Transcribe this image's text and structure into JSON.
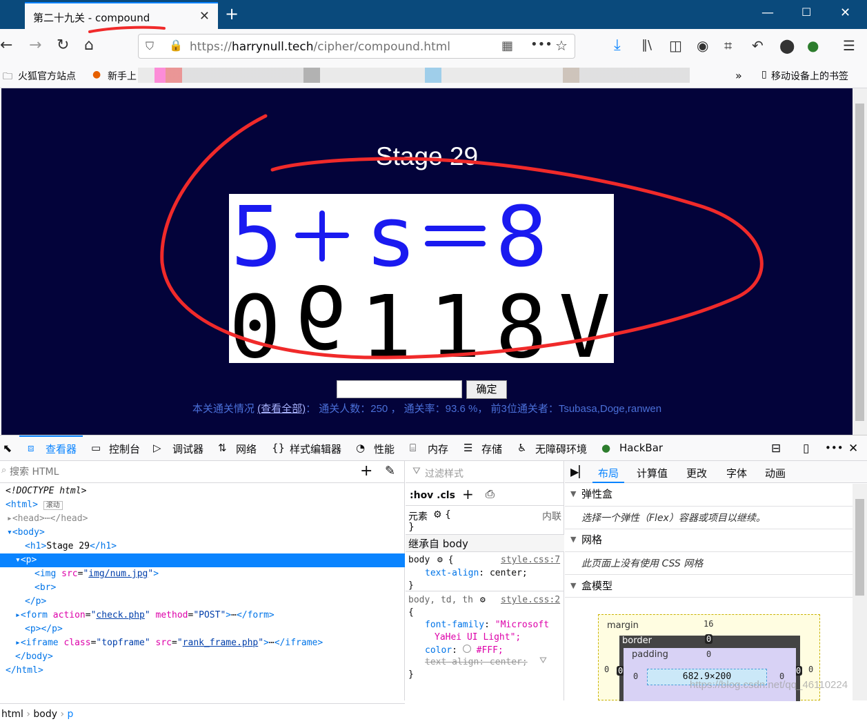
{
  "browser": {
    "tab_title": "第二十九关 - compound",
    "url_prefix": "https://",
    "url_domain": "harrynull.tech",
    "url_path": "/cipher/compound.html",
    "bookmarks": [
      "火狐官方站点",
      "新手上"
    ],
    "bookmarks_right": "移动设备上的书签"
  },
  "page": {
    "title": "Stage 29",
    "puzzle_row1": [
      "5",
      "+",
      "ƨ",
      "=",
      "8"
    ],
    "puzzle_row2": [
      "0",
      "6",
      "1",
      "1",
      "8",
      "V"
    ],
    "submit_label": "确定",
    "rank_prefix": "本关通关情况",
    "rank_link": "(查看全部)",
    "rank_stats": "：  通关人数：250 ，  通关率：93.6 %，  前3位通关者：Tsubasa,Doge,ranwen"
  },
  "devtools": {
    "tabs": [
      "查看器",
      "控制台",
      "调试器",
      "网络",
      "样式编辑器",
      "性能",
      "内存",
      "存储",
      "无障碍环境",
      "HackBar"
    ],
    "search_placeholder": "搜索 HTML",
    "html_lines": [
      "<!DOCTYPE html>",
      "<html> 滚动",
      "▸<head>⋯</head>",
      "▾<body>",
      "  <h1>Stage 29</h1>",
      "▾<p>",
      "    <img src=\"img/num.jpg\">",
      "    <br>",
      "  </p>",
      "▸<form action=\"check.php\" method=\"POST\">⋯</form>",
      "  <p></p>",
      "▸<iframe class=\"topframe\" src=\"rank_frame.php\">⋯</iframe>",
      "  </body>",
      "</html>"
    ],
    "breadcrumbs": [
      "html",
      "body",
      "p"
    ],
    "rules": {
      "filter_placeholder": "过滤样式",
      "hov_cls": ":hov  .cls",
      "element_label": "元素",
      "inline_label": "内联",
      "inherited_label": "继承自 body",
      "rule1_selector": "body",
      "rule1_source": "style.css:7",
      "rule1_prop": "text-align",
      "rule1_value": "center;",
      "rule2_selector": "body, td, th",
      "rule2_source": "style.css:2",
      "rule2_font_prop": "font-family",
      "rule2_font_value1": "\"Microsoft",
      "rule2_font_value2": "YaHei UI Light\";",
      "rule2_color_prop": "color",
      "rule2_color_value": "#FFF;",
      "rule2_struck": "text-align: center;"
    },
    "layout": {
      "tabs": [
        "布局",
        "计算值",
        "更改",
        "字体",
        "动画"
      ],
      "flex_title": "弹性盒",
      "flex_note": "选择一个弹性（Flex）容器或项目以继续。",
      "grid_title": "网格",
      "grid_note": "此页面上没有使用 CSS 网格",
      "boxmodel_title": "盒模型",
      "margin_label": "margin",
      "border_label": "border",
      "padding_label": "padding",
      "margin_top": "16",
      "border_top": "0",
      "padding_top": "0",
      "content_size": "682.9×200",
      "side_values": "0"
    }
  },
  "watermark": "https://blog.csdn.net/qq_46110224",
  "colors": {
    "tab_bar": "#0a4a7c",
    "page_bg": "#03033a",
    "accent": "#0a84ff",
    "annotation": "#f02a2a"
  }
}
